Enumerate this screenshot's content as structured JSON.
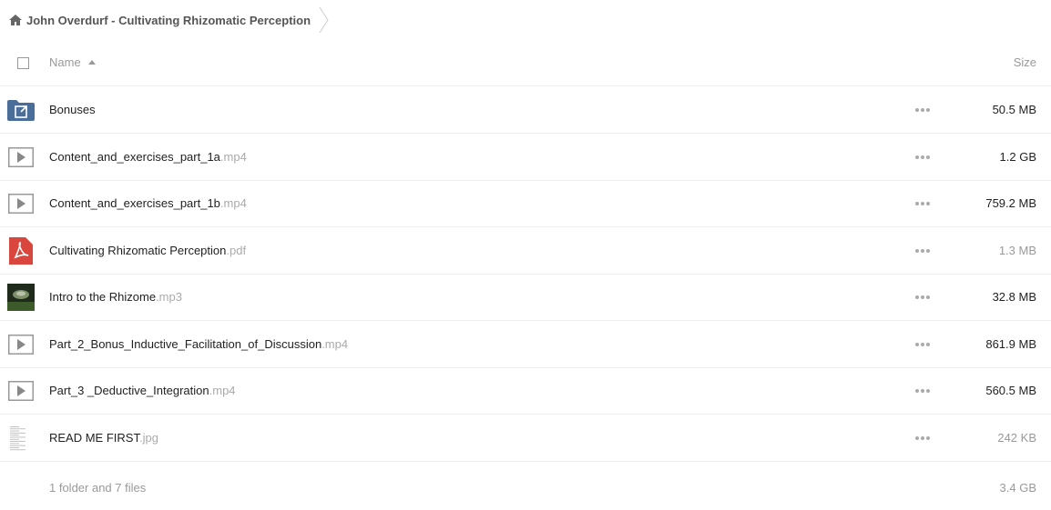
{
  "breadcrumb": {
    "folder_name": "John Overdurf - Cultivating Rhizomatic Perception",
    "icon": "home-icon"
  },
  "header": {
    "name_label": "Name",
    "size_label": "Size"
  },
  "files": [
    {
      "base": "Bonuses",
      "ext": "",
      "size": "50.5 MB",
      "type": "shared-folder",
      "size_muted": false
    },
    {
      "base": "Content_and_exercises_part_1a",
      "ext": ".mp4",
      "size": "1.2 GB",
      "type": "video",
      "size_muted": false
    },
    {
      "base": "Content_and_exercises_part_1b",
      "ext": ".mp4",
      "size": "759.2 MB",
      "type": "video",
      "size_muted": false
    },
    {
      "base": "Cultivating Rhizomatic Perception",
      "ext": ".pdf",
      "size": "1.3 MB",
      "type": "pdf",
      "size_muted": true
    },
    {
      "base": "Intro to the Rhizome",
      "ext": ".mp3",
      "size": "32.8 MB",
      "type": "audio-thumbnail",
      "size_muted": false
    },
    {
      "base": "Part_2_Bonus_Inductive_Facilitation_of_Discussion",
      "ext": ".mp4",
      "size": "861.9 MB",
      "type": "video",
      "size_muted": false
    },
    {
      "base": "Part_3 _Deductive_Integration",
      "ext": ".mp4",
      "size": "560.5 MB",
      "type": "video",
      "size_muted": false
    },
    {
      "base": "READ ME FIRST",
      "ext": ".jpg",
      "size": "242 KB",
      "type": "image-thumbnail",
      "size_muted": true
    }
  ],
  "summary": {
    "count_text": "1 folder and 7 files",
    "total_size": "3.4 GB"
  },
  "colors": {
    "folder_blue": "#4a6d9a",
    "pdf_red": "#d8463d",
    "muted_text": "#999999",
    "border": "#eeeeee"
  }
}
